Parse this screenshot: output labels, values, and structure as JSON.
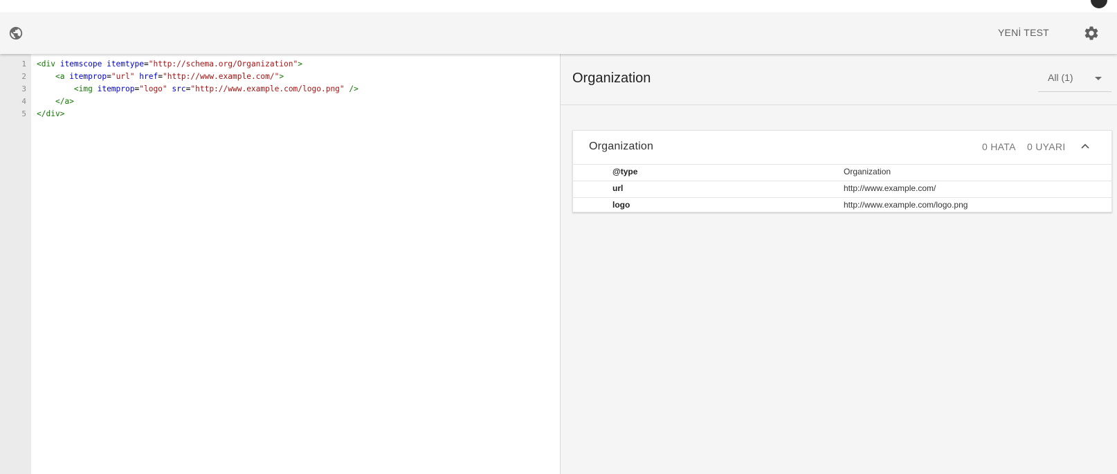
{
  "toolbar": {
    "new_test_label": "YENİ TEST",
    "left_icon": "globe-icon",
    "right_icon": "gear-icon"
  },
  "editor": {
    "line_numbers": [
      "1",
      "2",
      "3",
      "4",
      "5"
    ],
    "lines": [
      [
        {
          "t": "tag",
          "v": "<div"
        },
        {
          "t": "plain",
          "v": " "
        },
        {
          "t": "attr",
          "v": "itemscope"
        },
        {
          "t": "plain",
          "v": " "
        },
        {
          "t": "attr",
          "v": "itemtype"
        },
        {
          "t": "plain",
          "v": "="
        },
        {
          "t": "str",
          "v": "\"http://schema.org/Organization\""
        },
        {
          "t": "tag",
          "v": ">"
        }
      ],
      [
        {
          "t": "plain",
          "v": "    "
        },
        {
          "t": "tag",
          "v": "<a"
        },
        {
          "t": "plain",
          "v": " "
        },
        {
          "t": "attr",
          "v": "itemprop"
        },
        {
          "t": "plain",
          "v": "="
        },
        {
          "t": "str",
          "v": "\"url\""
        },
        {
          "t": "plain",
          "v": " "
        },
        {
          "t": "attr",
          "v": "href"
        },
        {
          "t": "plain",
          "v": "="
        },
        {
          "t": "str",
          "v": "\"http://www.example.com/\""
        },
        {
          "t": "tag",
          "v": ">"
        }
      ],
      [
        {
          "t": "plain",
          "v": "        "
        },
        {
          "t": "tag",
          "v": "<img"
        },
        {
          "t": "plain",
          "v": " "
        },
        {
          "t": "attr",
          "v": "itemprop"
        },
        {
          "t": "plain",
          "v": "="
        },
        {
          "t": "str",
          "v": "\"logo\""
        },
        {
          "t": "plain",
          "v": " "
        },
        {
          "t": "attr",
          "v": "src"
        },
        {
          "t": "plain",
          "v": "="
        },
        {
          "t": "str",
          "v": "\"http://www.example.com/logo.png\""
        },
        {
          "t": "plain",
          "v": " "
        },
        {
          "t": "tag",
          "v": "/>"
        }
      ],
      [
        {
          "t": "plain",
          "v": "    "
        },
        {
          "t": "tag",
          "v": "</a>"
        }
      ],
      [
        {
          "t": "tag",
          "v": "</div>"
        }
      ]
    ],
    "colors": {
      "tag": "#117700",
      "attr": "#0000cc",
      "string": "#aa1111"
    }
  },
  "results": {
    "title": "Organization",
    "filter_label": "All (1)",
    "card": {
      "title": "Organization",
      "errors": "0 HATA",
      "warnings": "0 UYARI",
      "expanded": true,
      "rows": [
        {
          "name": "@type",
          "value": "Organization"
        },
        {
          "name": "url",
          "value": "http://www.example.com/"
        },
        {
          "name": "logo",
          "value": "http://www.example.com/logo.png"
        }
      ]
    }
  }
}
